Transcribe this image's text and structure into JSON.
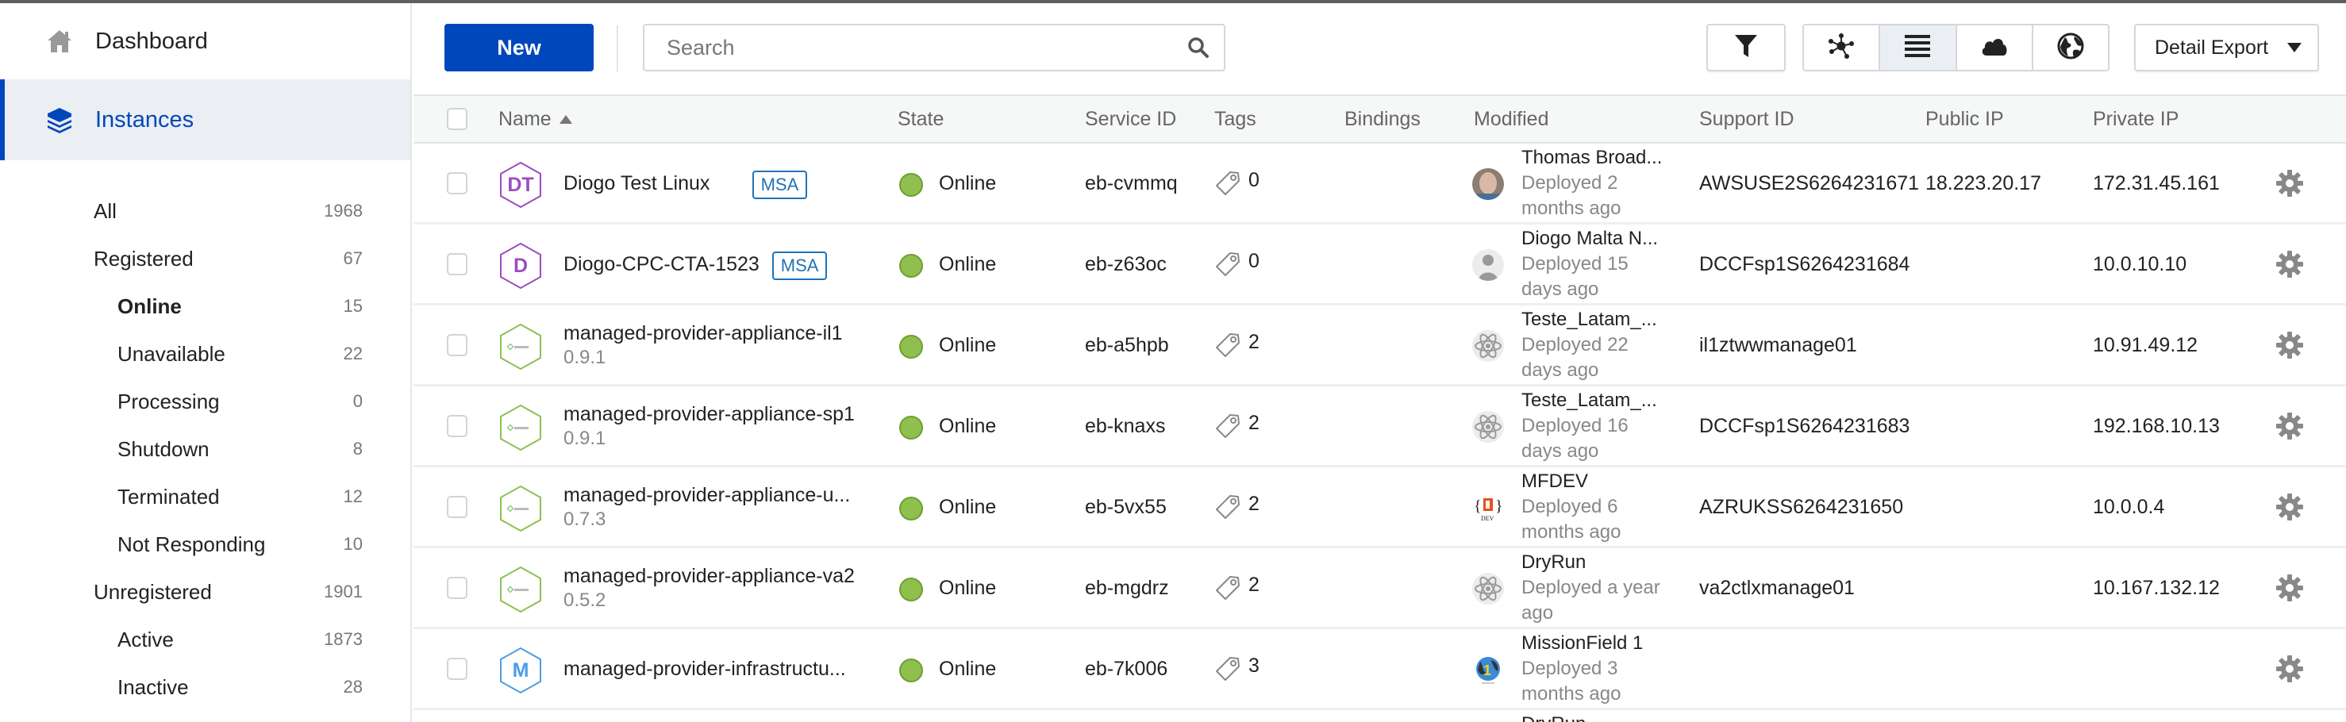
{
  "sidebar": {
    "nav": [
      {
        "label": "Dashboard",
        "icon": "home-icon",
        "active": false
      },
      {
        "label": "Instances",
        "icon": "layers-icon",
        "active": true
      }
    ],
    "filters": [
      {
        "label": "All",
        "count": "1968",
        "level": 0,
        "selected": false
      },
      {
        "label": "Registered",
        "count": "67",
        "level": 0,
        "selected": false
      },
      {
        "label": "Online",
        "count": "15",
        "level": 1,
        "selected": true
      },
      {
        "label": "Unavailable",
        "count": "22",
        "level": 1,
        "selected": false
      },
      {
        "label": "Processing",
        "count": "0",
        "level": 1,
        "selected": false
      },
      {
        "label": "Shutdown",
        "count": "8",
        "level": 1,
        "selected": false
      },
      {
        "label": "Terminated",
        "count": "12",
        "level": 1,
        "selected": false
      },
      {
        "label": "Not Responding",
        "count": "10",
        "level": 1,
        "selected": false
      },
      {
        "label": "Unregistered",
        "count": "1901",
        "level": 0,
        "selected": false
      },
      {
        "label": "Active",
        "count": "1873",
        "level": 1,
        "selected": false
      },
      {
        "label": "Inactive",
        "count": "28",
        "level": 1,
        "selected": false
      }
    ]
  },
  "toolbar": {
    "new_label": "New",
    "search_placeholder": "Search",
    "search_value": "",
    "filter_icon": "filter-icon",
    "views": [
      {
        "icon": "topology-icon",
        "active": false
      },
      {
        "icon": "list-icon",
        "active": true
      },
      {
        "icon": "cloud-icon",
        "active": false
      },
      {
        "icon": "globe-icon",
        "active": false
      }
    ],
    "export_label": "Detail Export"
  },
  "table": {
    "columns": {
      "name": "Name",
      "state": "State",
      "service_id": "Service ID",
      "tags": "Tags",
      "bindings": "Bindings",
      "modified": "Modified",
      "support_id": "Support ID",
      "public_ip": "Public IP",
      "private_ip": "Private IP"
    },
    "sort": {
      "column": "Name",
      "direction": "asc"
    },
    "rows": [
      {
        "icon_text": "DT",
        "icon_color": "#9b4dbf",
        "icon_kind": "initials",
        "name": "Diogo Test Linux",
        "version": "",
        "badge": "MSA",
        "state": "Online",
        "service_id": "eb-cvmmq",
        "tags": "0",
        "bindings": "",
        "modified_by": "Thomas Broad...",
        "modified_when": "Deployed 2 months ago",
        "avatar": "photo",
        "support_id": "AWSUSE2S6264231671",
        "public_ip": "18.223.20.17",
        "private_ip": "172.31.45.161"
      },
      {
        "icon_text": "D",
        "icon_color": "#9b4dbf",
        "icon_kind": "initials",
        "name": "Diogo-CPC-CTA-1523",
        "version": "",
        "badge": "MSA",
        "state": "Online",
        "service_id": "eb-z63oc",
        "tags": "0",
        "bindings": "",
        "modified_by": "Diogo Malta N...",
        "modified_when": "Deployed 15 days ago",
        "avatar": "silhouette",
        "support_id": "DCCFsp1S6264231684",
        "public_ip": "",
        "private_ip": "10.0.10.10"
      },
      {
        "icon_text": "",
        "icon_color": "#8cc152",
        "icon_kind": "brand",
        "name": "managed-provider-appliance-il1",
        "version": "0.9.1",
        "badge": "",
        "state": "Online",
        "service_id": "eb-a5hpb",
        "tags": "2",
        "bindings": "",
        "modified_by": "Teste_Latam_...",
        "modified_when": "Deployed 22 days ago",
        "avatar": "atom",
        "support_id": "il1ztwwmanage01",
        "public_ip": "",
        "private_ip": "10.91.49.12"
      },
      {
        "icon_text": "",
        "icon_color": "#8cc152",
        "icon_kind": "brand",
        "name": "managed-provider-appliance-sp1",
        "version": "0.9.1",
        "badge": "",
        "state": "Online",
        "service_id": "eb-knaxs",
        "tags": "2",
        "bindings": "",
        "modified_by": "Teste_Latam_...",
        "modified_when": "Deployed 16 days ago",
        "avatar": "atom",
        "support_id": "DCCFsp1S6264231683",
        "public_ip": "",
        "private_ip": "192.168.10.13"
      },
      {
        "icon_text": "",
        "icon_color": "#8cc152",
        "icon_kind": "brand",
        "name": "managed-provider-appliance-u...",
        "version": "0.7.3",
        "badge": "",
        "state": "Online",
        "service_id": "eb-5vx55",
        "tags": "2",
        "bindings": "",
        "modified_by": "MFDEV",
        "modified_when": "Deployed 6 months ago",
        "avatar": "office-dev",
        "support_id": "AZRUKSS6264231650",
        "public_ip": "",
        "private_ip": "10.0.0.4"
      },
      {
        "icon_text": "",
        "icon_color": "#8cc152",
        "icon_kind": "brand",
        "name": "managed-provider-appliance-va2",
        "version": "0.5.2",
        "badge": "",
        "state": "Online",
        "service_id": "eb-mgdrz",
        "tags": "2",
        "bindings": "",
        "modified_by": "DryRun",
        "modified_when": "Deployed a year ago",
        "avatar": "atom",
        "support_id": "va2ctlxmanage01",
        "public_ip": "",
        "private_ip": "10.167.132.12"
      },
      {
        "icon_text": "M",
        "icon_color": "#4a9de6",
        "icon_kind": "initials",
        "name": "managed-provider-infrastructu...",
        "version": "",
        "badge": "",
        "state": "Online",
        "service_id": "eb-7k006",
        "tags": "3",
        "bindings": "",
        "modified_by": "MissionField 1",
        "modified_when": "Deployed 3 months ago",
        "avatar": "globe-one",
        "support_id": "",
        "public_ip": "",
        "private_ip": ""
      }
    ],
    "partial_row": {
      "modified_by": "DryRun"
    }
  },
  "colors": {
    "brand": "#0047bb",
    "online": "#8fbf4d",
    "badge": "#1f73b7"
  }
}
